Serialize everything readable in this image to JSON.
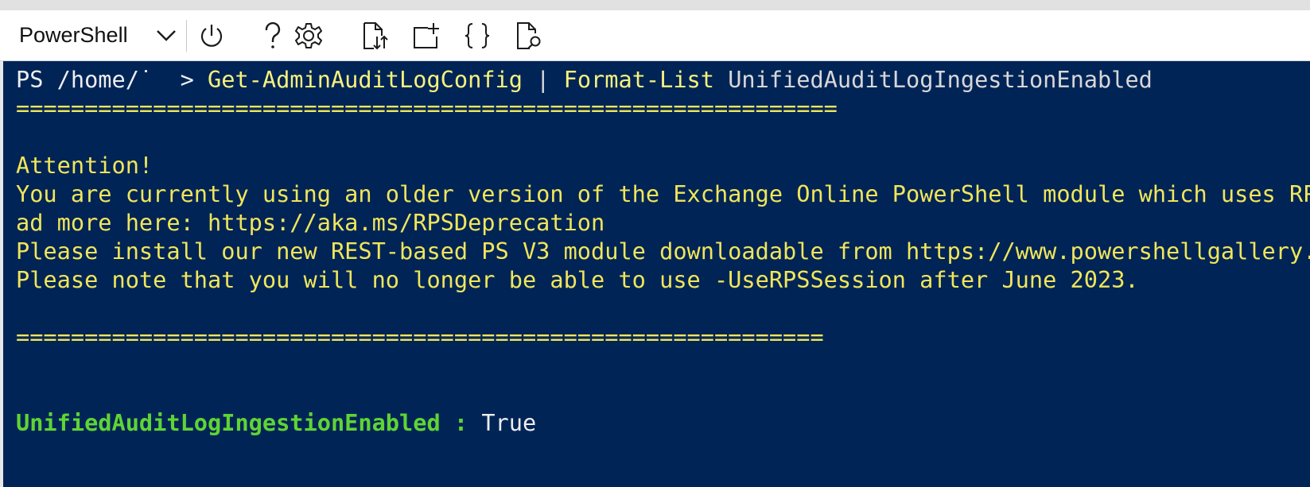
{
  "toolbar": {
    "shell": "PowerShell",
    "buttons": [
      {
        "name": "restart-icon",
        "glyph": "⏻"
      },
      {
        "name": "help-icon",
        "glyph": "?"
      },
      {
        "name": "settings-icon",
        "glyph": "⚙"
      },
      {
        "name": "upload-download-icon",
        "glyph": "⇅"
      },
      {
        "name": "new-session-icon",
        "glyph": "+"
      },
      {
        "name": "editor-icon",
        "glyph": "{ }"
      },
      {
        "name": "web-preview-icon",
        "glyph": "⌕"
      }
    ]
  },
  "terminal": {
    "prompt": "PS /home/˙  > ",
    "command1": "Get-AdminAuditLogConfig",
    "pipe": " | ",
    "command2": "Format-List",
    "argument": " UnifiedAuditLogIngestionEnabled",
    "separator_top": "============================================================",
    "attention": "Attention!",
    "warning_line1": "You are currently using an older version of the Exchange Online PowerShell module which uses RPS",
    "warning_line2": "ad more here: https://aka.ms/RPSDeprecation",
    "warning_line3": "Please install our new REST-based PS V3 module downloadable from https://www.powershellgallery.c",
    "warning_line4": "Please note that you will no longer be able to use -UseRPSSession after June 2023.",
    "separator_bottom": "===========================================================",
    "result_key": "UnifiedAuditLogIngestionEnabled : ",
    "result_value": "True"
  },
  "colors": {
    "terminal_background": "#012456",
    "warning_text": "#f0e65a",
    "property_name": "#5fd435"
  }
}
